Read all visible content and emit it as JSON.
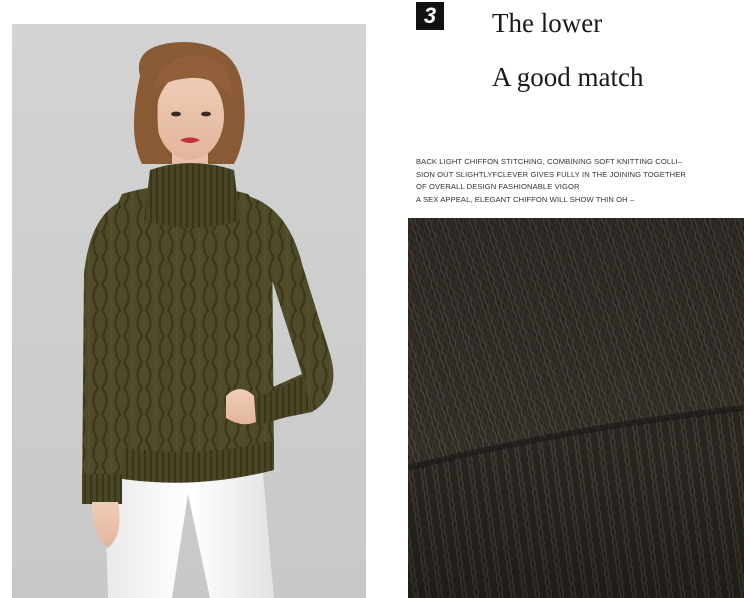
{
  "step_badge": "3",
  "headline": {
    "line1": "The lower",
    "line2": "A good match"
  },
  "description_lines": [
    "BACK LIGHT CHIFFON STITCHING, COMBINING SOFT KNITTING COLLI–",
    "SION OUT SLIGHTLYFCLEVER GIVES FULLY IN THE JOINING TOGETHER",
    "OF OVERALL DESIGN FASHIONABLE VIGOR",
    "A SEX APPEAL, ELEGANT CHIFFON WILL SHOW THIN OH –"
  ],
  "colors": {
    "sweater": "#4f4a28",
    "sweater_dark": "#3e3a1e",
    "fabric": "#2e2924",
    "panel_bg": "#cfcfcf"
  }
}
